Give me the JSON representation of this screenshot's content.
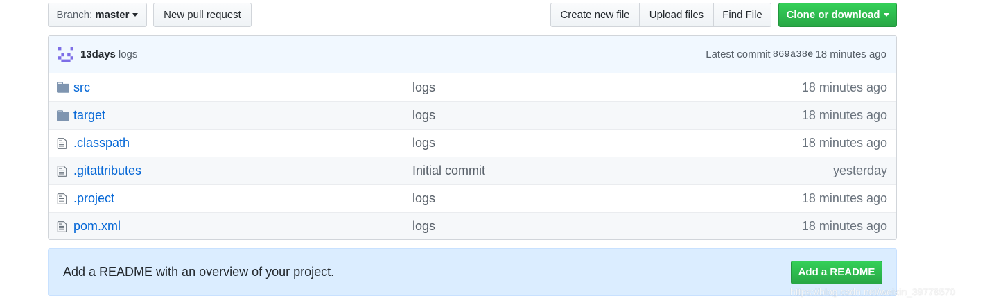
{
  "toolbar": {
    "branch_prefix": "Branch:",
    "branch_name": "master",
    "new_pr": "New pull request",
    "create_file": "Create new file",
    "upload_files": "Upload files",
    "find_file": "Find File",
    "clone": "Clone or download"
  },
  "commit": {
    "author": "13days",
    "message": "logs",
    "latest_label": "Latest commit",
    "sha": "869a38e",
    "age": "18 minutes ago"
  },
  "files": [
    {
      "name": "src",
      "type": "folder",
      "icon": "folder-icon",
      "message": "logs",
      "age": "18 minutes ago"
    },
    {
      "name": "target",
      "type": "folder",
      "icon": "folder-icon",
      "message": "logs",
      "age": "18 minutes ago"
    },
    {
      "name": ".classpath",
      "type": "file",
      "icon": "file-icon",
      "message": "logs",
      "age": "18 minutes ago"
    },
    {
      "name": ".gitattributes",
      "type": "file",
      "icon": "file-icon",
      "message": "Initial commit",
      "age": "yesterday"
    },
    {
      "name": ".project",
      "type": "file",
      "icon": "file-icon",
      "message": "logs",
      "age": "18 minutes ago"
    },
    {
      "name": "pom.xml",
      "type": "file",
      "icon": "file-icon",
      "message": "logs",
      "age": "18 minutes ago"
    }
  ],
  "readme": {
    "text": "Add a README with an overview of your project.",
    "button": "Add a README"
  },
  "watermark": "https://blog.csdn.net/weixin_39778570",
  "colors": {
    "link": "#0366d6",
    "green": "#28a745",
    "commit_bg": "#f1f8ff",
    "readme_bg": "#dbedff",
    "icon": "#6a737d"
  }
}
